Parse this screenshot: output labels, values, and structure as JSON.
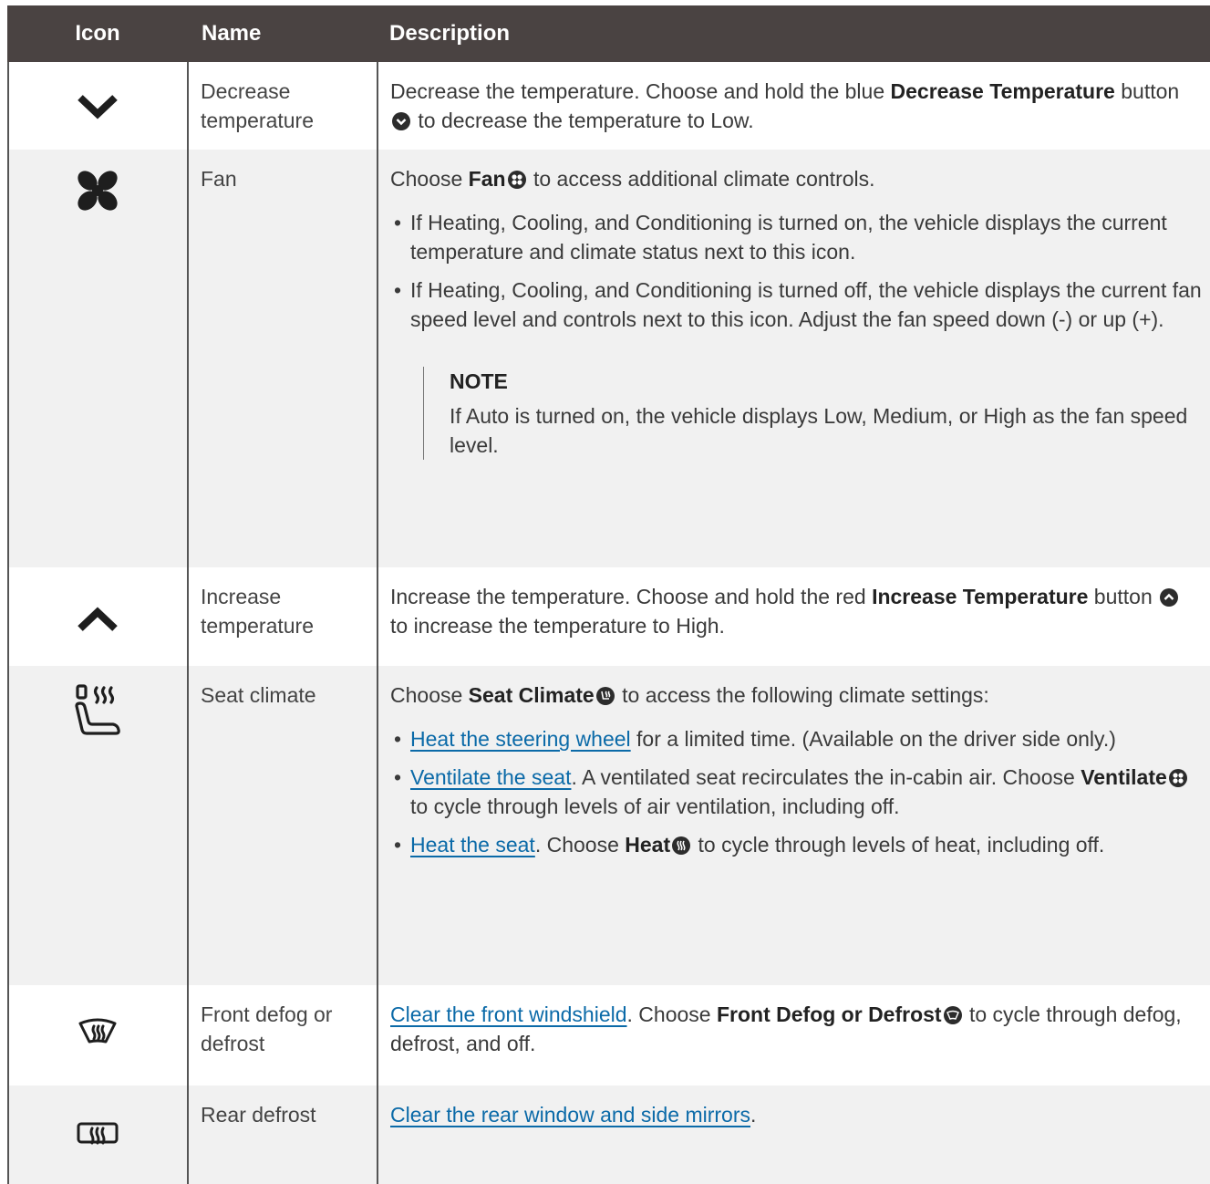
{
  "header": {
    "col_icon": "Icon",
    "col_name": "Name",
    "col_desc": "Description"
  },
  "rows": {
    "decrease": {
      "icon": "chevron-down-icon",
      "name": "Decrease temperature",
      "desc_1": "Decrease the temperature. Choose and hold the blue ",
      "desc_bold": "Decrease Temperature",
      "desc_2": " button ",
      "desc_3": " to decrease the temperature to Low."
    },
    "fan": {
      "icon": "fan-icon",
      "name": "Fan",
      "desc_1": "Choose ",
      "desc_bold": "Fan",
      "desc_2": " to access additional climate controls.",
      "bullet_1": "If Heating, Cooling, and Conditioning is turned on, the vehicle displays the current temperature and climate status next to this icon.",
      "bullet_2": "If Heating, Cooling, and Conditioning is turned off, the vehicle displays the current fan speed level and controls next to this icon. Adjust the fan speed down (-) or up (+).",
      "note_title": "NOTE",
      "note_text": "If Auto is turned on, the vehicle displays Low, Medium, or High as the fan speed level."
    },
    "increase": {
      "icon": "chevron-up-icon",
      "name": "Increase temperature",
      "desc_1": "Increase the temperature. Choose and hold the red ",
      "desc_bold": "Increase Temperature",
      "desc_2": " button ",
      "desc_3": " to increase the temperature to High."
    },
    "seat": {
      "icon": "seat-climate-icon",
      "name": "Seat climate",
      "desc_1": "Choose ",
      "desc_bold": "Seat Climate",
      "desc_2": " to access the following climate settings:",
      "b1_link": "Heat the steering wheel",
      "b1_text": " for a limited time. (Available on the driver side only.)",
      "b2_link": "Ventilate the seat",
      "b2_text_1": ". A ventilated seat recirculates the in-cabin air. Choose ",
      "b2_bold": "Ventilate",
      "b2_text_2": " to cycle through levels of air ventilation, including off.",
      "b3_link": "Heat the seat",
      "b3_text_1": ". Choose ",
      "b3_bold": "Heat",
      "b3_text_2": " to cycle through levels of heat, including off."
    },
    "front": {
      "icon": "front-defrost-icon",
      "name": "Front defog or defrost",
      "link": "Clear the front windshield",
      "desc_1": ". Choose ",
      "desc_bold": "Front Defog or Defrost",
      "desc_2": " to cycle through defog, defrost, and off."
    },
    "rear": {
      "icon": "rear-defrost-icon",
      "name": "Rear defrost",
      "link": "Clear the rear window and side mirrors",
      "desc_1": "."
    }
  },
  "colors": {
    "header_bg": "#4a4342",
    "shaded_row": "#f1f1f1",
    "link": "#0b6aa8"
  }
}
